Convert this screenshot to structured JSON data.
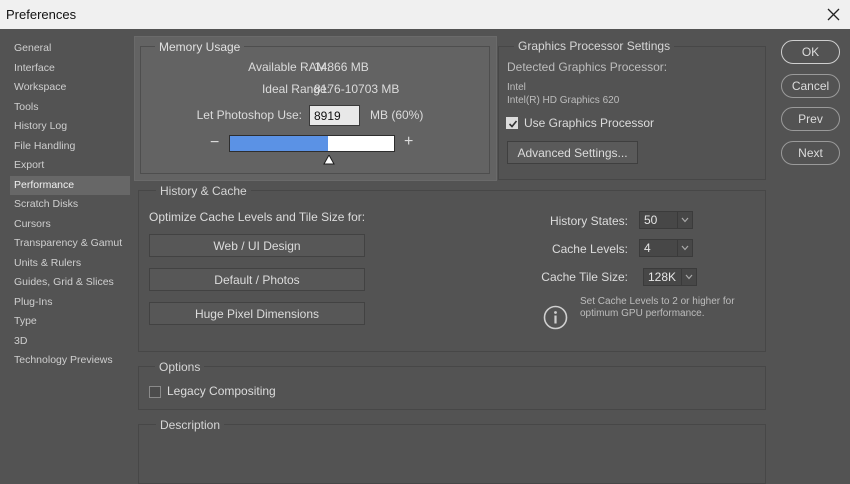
{
  "window": {
    "title": "Preferences"
  },
  "sidebar": {
    "items": [
      {
        "label": "General"
      },
      {
        "label": "Interface"
      },
      {
        "label": "Workspace"
      },
      {
        "label": "Tools"
      },
      {
        "label": "History Log"
      },
      {
        "label": "File Handling"
      },
      {
        "label": "Export"
      },
      {
        "label": "Performance"
      },
      {
        "label": "Scratch Disks"
      },
      {
        "label": "Cursors"
      },
      {
        "label": "Transparency & Gamut"
      },
      {
        "label": "Units & Rulers"
      },
      {
        "label": "Guides, Grid & Slices"
      },
      {
        "label": "Plug-Ins"
      },
      {
        "label": "Type"
      },
      {
        "label": "3D"
      },
      {
        "label": "Technology Previews"
      }
    ],
    "selected": "Performance"
  },
  "memory": {
    "legend": "Memory Usage",
    "available_label": "Available RAM:",
    "available_value": "14866 MB",
    "ideal_label": "Ideal Range:",
    "ideal_value": "8176-10703 MB",
    "use_label": "Let Photoshop Use:",
    "use_value": "8919",
    "use_suffix": "MB (60%)",
    "minus": "−",
    "plus": "+",
    "slider_fraction": 0.6
  },
  "gpu": {
    "legend": "Graphics Processor Settings",
    "detected_label": "Detected Graphics Processor:",
    "vendor": "Intel",
    "model": "Intel(R) HD Graphics 620",
    "use_gpu_label": "Use Graphics Processor",
    "use_gpu_checked": true,
    "advanced_button": "Advanced Settings..."
  },
  "history_cache": {
    "legend": "History & Cache",
    "optimize_label": "Optimize Cache Levels and Tile Size for:",
    "buttons": [
      "Web / UI Design",
      "Default / Photos",
      "Huge Pixel Dimensions"
    ],
    "history_states_label": "History States:",
    "history_states_value": "50",
    "cache_levels_label": "Cache Levels:",
    "cache_levels_value": "4",
    "cache_tile_label": "Cache Tile Size:",
    "cache_tile_value": "128K",
    "info_text_1": "Set Cache Levels to 2 or higher for",
    "info_text_2": "optimum GPU performance."
  },
  "options": {
    "legend": "Options",
    "legacy_label": "Legacy Compositing",
    "legacy_checked": false
  },
  "description": {
    "legend": "Description"
  },
  "actions": {
    "ok": "OK",
    "cancel": "Cancel",
    "prev": "Prev",
    "next": "Next"
  }
}
